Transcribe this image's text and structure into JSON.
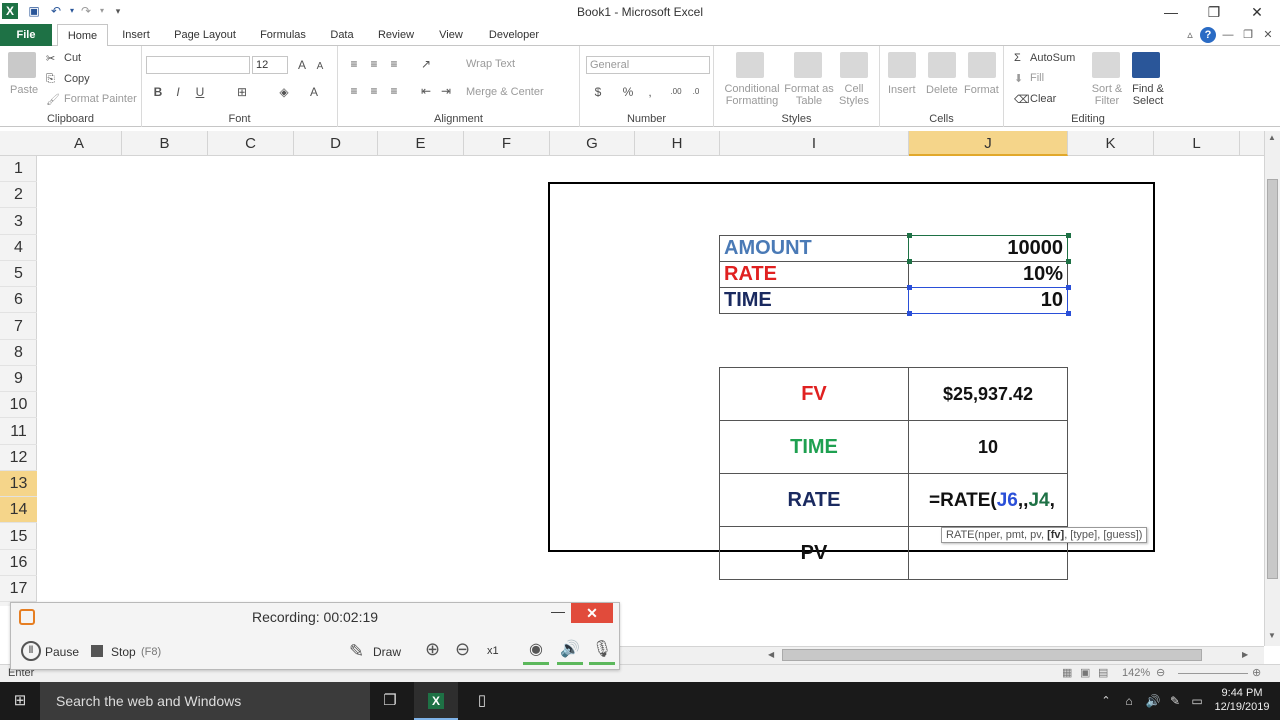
{
  "window": {
    "title": "Book1  -  Microsoft Excel"
  },
  "tabs": [
    {
      "label": "File"
    },
    {
      "label": "Home"
    },
    {
      "label": "Insert"
    },
    {
      "label": "Page Layout"
    },
    {
      "label": "Formulas"
    },
    {
      "label": "Data"
    },
    {
      "label": "Review"
    },
    {
      "label": "View"
    },
    {
      "label": "Developer"
    }
  ],
  "ribbon": {
    "clipboard": {
      "label": "Clipboard",
      "paste": "Paste",
      "cut": "Cut",
      "copy": "Copy",
      "format_painter": "Format Painter"
    },
    "font": {
      "label": "Font",
      "font_name": "",
      "font_size": "12"
    },
    "alignment": {
      "label": "Alignment",
      "wrap_text": "Wrap Text",
      "merge_center": "Merge & Center"
    },
    "number": {
      "label": "Number",
      "format": "General"
    },
    "styles": {
      "label": "Styles",
      "conditional": "Conditional Formatting",
      "format_table": "Format as Table",
      "cell_styles": "Cell Styles"
    },
    "cells": {
      "label": "Cells",
      "insert": "Insert",
      "delete": "Delete",
      "format": "Format"
    },
    "editing": {
      "label": "Editing",
      "autosum": "AutoSum",
      "fill": "Fill",
      "clear": "Clear",
      "sort_filter": "Sort & Filter",
      "find_select": "Find & Select"
    }
  },
  "columns": [
    "A",
    "B",
    "C",
    "D",
    "E",
    "F",
    "G",
    "H",
    "I",
    "J",
    "K",
    "L"
  ],
  "rows": [
    "1",
    "2",
    "3",
    "4",
    "5",
    "6",
    "7",
    "8",
    "9",
    "10",
    "11",
    "12",
    "13",
    "14",
    "15",
    "16",
    "17"
  ],
  "table1": {
    "rows": [
      {
        "label": "AMOUNT",
        "value": "10000",
        "color": "#4a7ab6"
      },
      {
        "label": "RATE",
        "value": "10%",
        "color": "#e02020"
      },
      {
        "label": "TIME",
        "value": "10",
        "color": "#1a2a60"
      }
    ]
  },
  "table2": {
    "rows": [
      {
        "label": "FV",
        "value": "$25,937.42",
        "color": "#e02020"
      },
      {
        "label": "TIME",
        "value": "10",
        "color": "#1ea050"
      },
      {
        "label": "RATE",
        "value_prefix": "=RATE(",
        "ref1": "J6",
        "sep": ",,",
        "ref2": "J4",
        "suffix": ",",
        "color": "#1a2a60"
      },
      {
        "label": "PV",
        "value": "",
        "color": "#111111"
      }
    ]
  },
  "tooltip": {
    "pre": "RATE(nper, pmt, pv, ",
    "bold": "[fv]",
    "post": ", [type], [guess])"
  },
  "status": {
    "mode": "Enter",
    "zoom": "142%"
  },
  "recorder": {
    "title": "Recording:  00:02:19",
    "pause": "Pause",
    "stop": "Stop",
    "stop_key": "(F8)",
    "draw": "Draw",
    "zoom_level": "x1"
  },
  "taskbar": {
    "search": "Search the web and Windows",
    "time": "9:44 PM",
    "date": "12/19/2019"
  },
  "colors": {
    "excel_green": "#1e7145",
    "selection": "#f5d58a"
  }
}
